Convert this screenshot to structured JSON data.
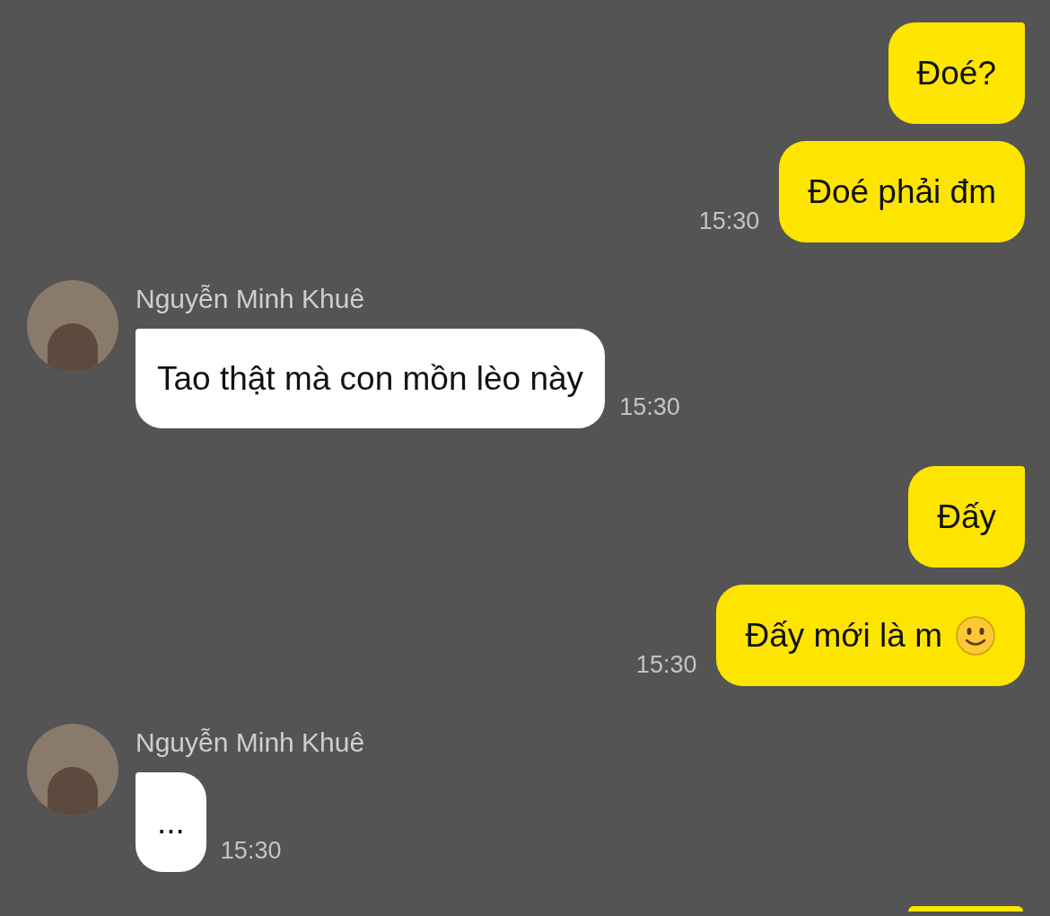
{
  "messages": [
    {
      "kind": "sent",
      "text": "Đoé?",
      "tail": true
    },
    {
      "kind": "sent",
      "text": "Đoé phải đm",
      "tail": false,
      "time": "15:30"
    },
    {
      "kind": "received",
      "sender": "Nguyễn Minh Khuê",
      "text": "Tao thật mà con mồn lèo này",
      "time": "15:30"
    },
    {
      "kind": "sent",
      "text": "Đấy",
      "tail": true
    },
    {
      "kind": "sent",
      "text": "Đấy mới là m",
      "emoji": true,
      "tail": false,
      "time": "15:30"
    },
    {
      "kind": "received",
      "sender": "Nguyễn Minh Khuê",
      "text": "...",
      "time": "15:30"
    },
    {
      "kind": "partial"
    }
  ]
}
